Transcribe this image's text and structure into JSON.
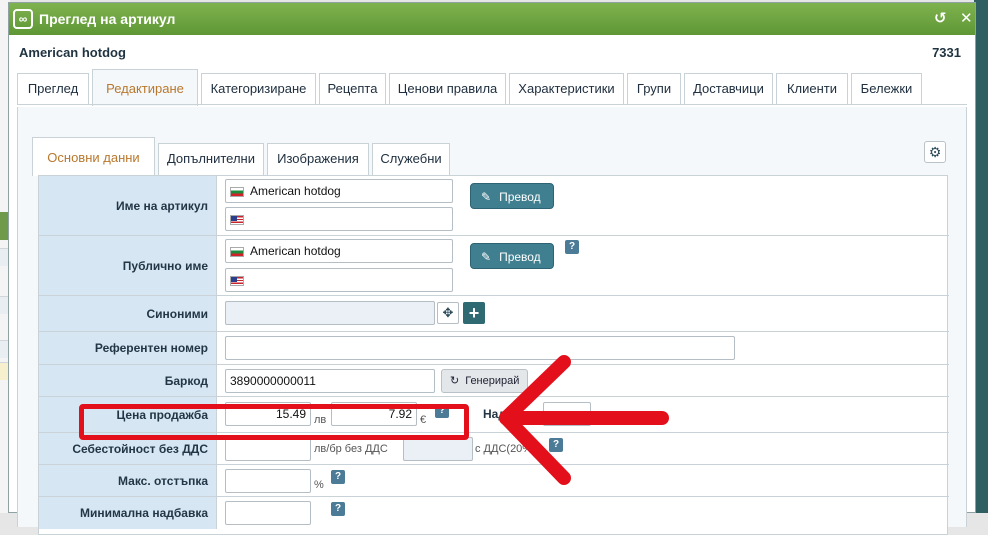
{
  "window": {
    "title": "Преглед на артикул",
    "item_name": "American hotdog",
    "item_id": "7331"
  },
  "tabs_top": [
    "Преглед",
    "Редактиране",
    "Категоризиране",
    "Рецепта",
    "Ценови правила",
    "Характеристики",
    "Групи",
    "Доставчици",
    "Клиенти",
    "Бележки"
  ],
  "tabs_top_active": "Редактиране",
  "tabs_inner": [
    "Основни данни",
    "Допълнителни",
    "Изображения",
    "Служебни"
  ],
  "tabs_inner_active": "Основни данни",
  "form": {
    "name": {
      "label": "Име на артикул",
      "value_bg": "American hotdog",
      "value_en": "",
      "translate": "Превод"
    },
    "public_name": {
      "label": "Публично име",
      "value_bg": "American hotdog",
      "value_en": "",
      "translate": "Превод",
      "help": "?"
    },
    "synonyms": {
      "label": "Синоними",
      "value": ""
    },
    "reference": {
      "label": "Референтен номер",
      "value": ""
    },
    "barcode": {
      "label": "Баркод",
      "value": "3890000000011",
      "generate": "Генерирай"
    },
    "sale_price": {
      "label": "Цена продажба",
      "value_lv": "15.49",
      "unit_lv": "лв",
      "value_eur": "7.92",
      "unit_eur": "€",
      "help": "?",
      "markup_label": "Над"
    },
    "cost": {
      "label": "Себестойност без ДДС",
      "unit_no_vat": "лв/бр без ДДС",
      "unit_vat": "с ДДС(20%)"
    },
    "max_discount": {
      "label": "Макс. отстъпка",
      "unit": "%"
    },
    "min_markup": {
      "label": "Минимална надбавка"
    }
  },
  "colors": {
    "titlebar": "#6aa33f",
    "accent_tab": "#b8782d",
    "annotation": "#e3101c",
    "teal_button": "#3f7f8f"
  },
  "icons": [
    "link-icon",
    "history-icon",
    "close-icon",
    "gear-icon",
    "pencil-icon",
    "move-icon",
    "plus-icon",
    "refresh-icon",
    "help-icon",
    "bg-flag-icon",
    "us-flag-icon"
  ]
}
